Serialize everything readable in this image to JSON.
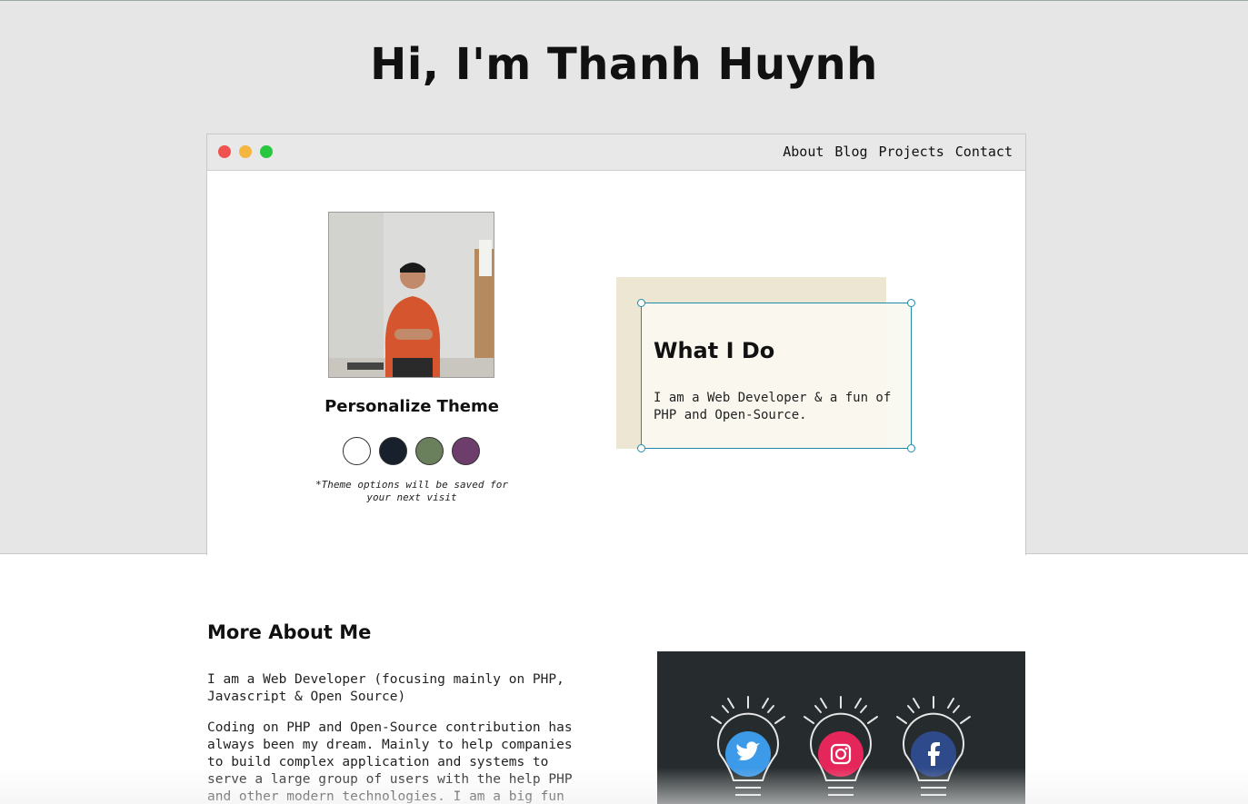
{
  "hero": {
    "title": "Hi, I'm Thanh Huynh"
  },
  "nav": {
    "items": [
      "About",
      "Blog",
      "Projects",
      "Contact"
    ]
  },
  "profile": {
    "theme_title": "Personalize Theme",
    "theme_note": "*Theme options will be saved for your next visit",
    "swatches": [
      {
        "name": "white",
        "color": "#ffffff"
      },
      {
        "name": "navy",
        "color": "#17202b"
      },
      {
        "name": "sage",
        "color": "#6a7f5b"
      },
      {
        "name": "plum",
        "color": "#6d3e6b"
      }
    ]
  },
  "what_i_do": {
    "title": "What I Do",
    "text": "I am a Web Developer & a fun of PHP and Open-Source."
  },
  "about": {
    "title": "More About Me",
    "p1": "I am a Web Developer (focusing mainly on PHP, Javascript & Open Source)",
    "p2": "Coding on PHP and Open-Source contribution has always been my dream. Mainly to help companies to build complex application and systems to serve a large group of users with the help PHP and other modern technologies. I am a big fun"
  },
  "social": [
    {
      "name": "twitter",
      "icon": "twitter-icon",
      "color": "#3d9ae8"
    },
    {
      "name": "instagram",
      "icon": "instagram-icon",
      "color": "#e5265a"
    },
    {
      "name": "facebook",
      "icon": "facebook-icon",
      "color": "#2f4a8a"
    }
  ]
}
